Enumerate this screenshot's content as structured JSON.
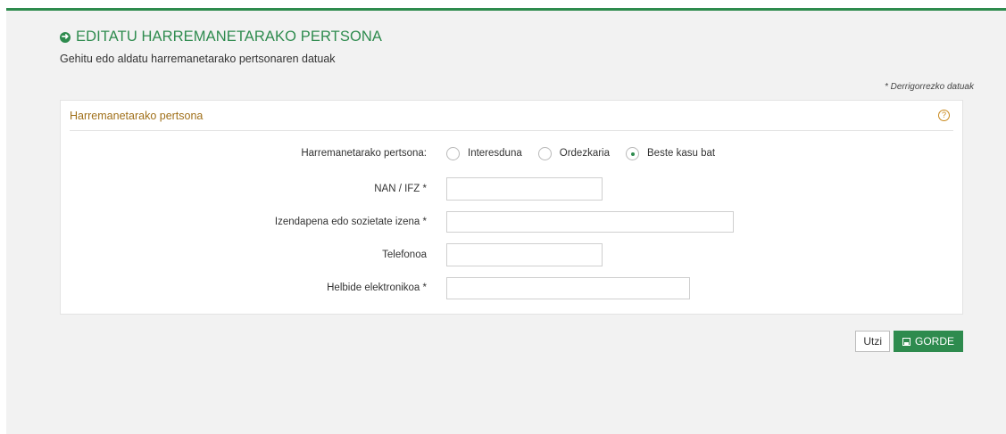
{
  "header": {
    "title": "EDITATU HARREMANETARAKO PERTSONA",
    "subtitle": "Gehitu edo aldatu harremanetarako pertsonaren datuak",
    "required_note": "* Derrigorrezko datuak"
  },
  "panel": {
    "title": "Harremanetarako pertsona",
    "help_icon": "?"
  },
  "form": {
    "contact_label": "Harremanetarako pertsona:",
    "options": [
      {
        "label": "Interesduna",
        "checked": false
      },
      {
        "label": "Ordezkaria",
        "checked": false
      },
      {
        "label": "Beste kasu bat",
        "checked": true
      }
    ],
    "nan_label": "NAN / IFZ *",
    "nan_value": "",
    "name_label": "Izendapena edo sozietate izena *",
    "name_value": "",
    "phone_label": "Telefonoa",
    "phone_value": "",
    "email_label": "Helbide elektronikoa *",
    "email_value": ""
  },
  "actions": {
    "cancel_label": "Utzi",
    "save_label": "GORDE"
  },
  "colors": {
    "accent": "#2e8b4e",
    "panel_title": "#a0701a"
  }
}
